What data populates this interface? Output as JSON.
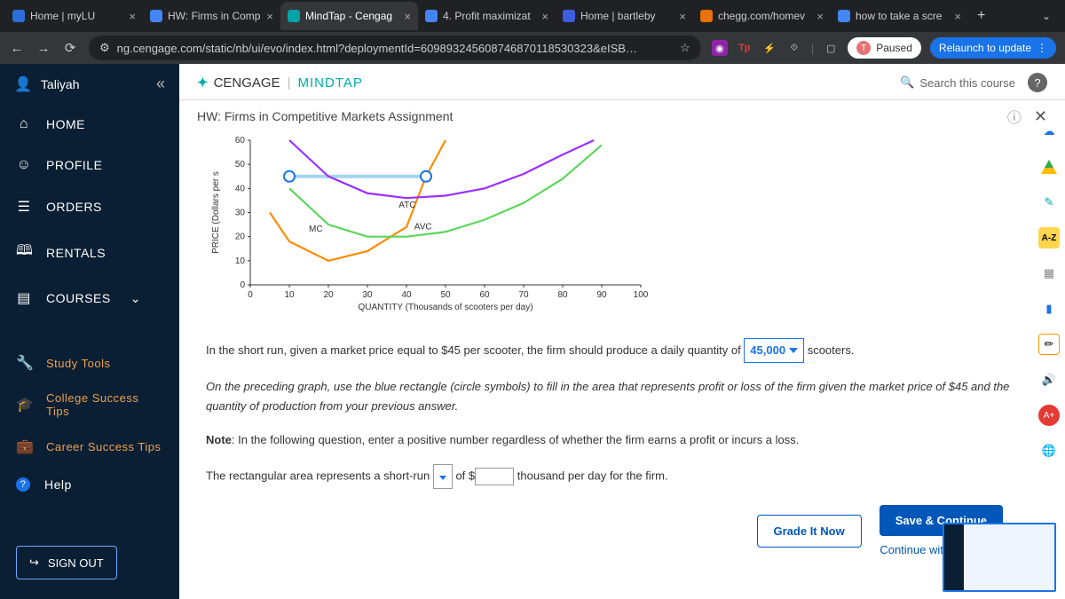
{
  "tabs": [
    {
      "title": "Home | myLU",
      "fav": "#2a6fd6"
    },
    {
      "title": "HW: Firms in Comp",
      "fav": "#4285f4"
    },
    {
      "title": "MindTap - Cengag",
      "fav": "#00a4a6",
      "active": true
    },
    {
      "title": "4. Profit maximizat",
      "fav": "#4285f4"
    },
    {
      "title": "Home | bartleby",
      "fav": "#3b5fe0"
    },
    {
      "title": "chegg.com/homev",
      "fav": "#eb7100"
    },
    {
      "title": "how to take a scre",
      "fav": "#4285f4"
    }
  ],
  "url": "ng.cengage.com/static/nb/ui/evo/index.html?deploymentId=609893245608746870118530323&eISB…",
  "paused": "Paused",
  "relaunch": "Relaunch to update",
  "user": "Taliyah",
  "sidebar": {
    "home": "HOME",
    "profile": "PROFILE",
    "orders": "ORDERS",
    "rentals": "RENTALS",
    "courses": "COURSES",
    "study": "Study Tools",
    "college": "College Success Tips",
    "career": "Career Success Tips",
    "help": "Help",
    "signout": "SIGN OUT"
  },
  "brand": {
    "c": "CENGAGE",
    "m": "MINDTAP"
  },
  "search": "Search this course",
  "assignment": "HW: Firms in Competitive Markets Assignment",
  "q1a": "In the short run, given a market price equal to $45 per scooter, the firm should produce a daily quantity of ",
  "q1_sel": "45,000",
  "q1b": " scooters.",
  "q2": "On the preceding graph, use the blue rectangle (circle symbols) to fill in the area that represents profit or loss of the firm given the market price of $45 and the quantity of production from your previous answer.",
  "note_label": "Note",
  "note": ": In the following question, enter a positive number regardless of whether the firm earns a profit or incurs a loss.",
  "q3a": "The rectangular area represents a short-run ",
  "q3b": " of ",
  "q3_prefix": "$",
  "q3c": " thousand per day for the firm.",
  "grade": "Grade It Now",
  "save": "Save & Continue",
  "cont": "Continue without saving",
  "chart_data": {
    "type": "line",
    "xlabel": "QUANTITY (Thousands of scooters per day)",
    "ylabel": "PRICE (Dollars per s",
    "xlim": [
      0,
      100
    ],
    "ylim": [
      0,
      60
    ],
    "xticks": [
      0,
      10,
      20,
      30,
      40,
      50,
      60,
      70,
      80,
      90,
      100
    ],
    "yticks": [
      0,
      10,
      20,
      30,
      40,
      50,
      60
    ],
    "series": [
      {
        "name": "MC",
        "color": "#ff8c00",
        "points": [
          [
            5,
            30
          ],
          [
            10,
            18
          ],
          [
            20,
            10
          ],
          [
            30,
            14
          ],
          [
            40,
            24
          ],
          [
            45,
            45
          ],
          [
            50,
            60
          ]
        ]
      },
      {
        "name": "ATC",
        "color": "#9b30ff",
        "points": [
          [
            10,
            60
          ],
          [
            20,
            45
          ],
          [
            30,
            38
          ],
          [
            40,
            36
          ],
          [
            50,
            37
          ],
          [
            60,
            40
          ],
          [
            70,
            46
          ],
          [
            80,
            54
          ],
          [
            88,
            60
          ]
        ]
      },
      {
        "name": "AVC",
        "color": "#5cd65c",
        "points": [
          [
            10,
            40
          ],
          [
            20,
            25
          ],
          [
            30,
            20
          ],
          [
            40,
            20
          ],
          [
            50,
            22
          ],
          [
            60,
            27
          ],
          [
            70,
            34
          ],
          [
            80,
            44
          ],
          [
            90,
            58
          ]
        ]
      }
    ],
    "rect": {
      "x": [
        10,
        45
      ],
      "y": [
        45,
        45
      ],
      "color": "#6bb7e8",
      "handles": [
        [
          10,
          45
        ],
        [
          45,
          45
        ]
      ]
    },
    "annotations": [
      {
        "text": "MC",
        "x": 15,
        "y": 22
      },
      {
        "text": "ATC",
        "x": 38,
        "y": 32
      },
      {
        "text": "AVC",
        "x": 42,
        "y": 23
      }
    ]
  }
}
